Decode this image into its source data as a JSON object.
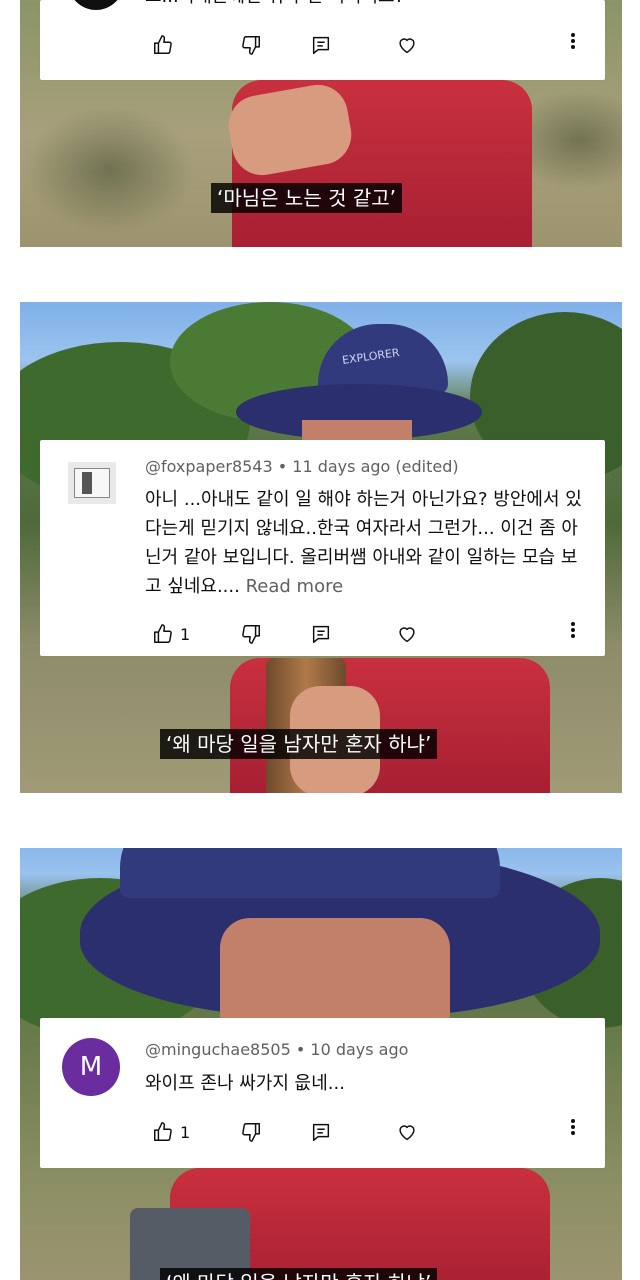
{
  "comments": [
    {
      "author_line": "",
      "text": "그...아내분께선 뭐하 신 여지리요?",
      "more_label": "",
      "likes": "",
      "avatar_letter": "",
      "avatar_color": "#0f0f0f"
    },
    {
      "author_line": "@foxpaper8543 • 11 days ago (edited)",
      "text": "아니 ...아내도 같이 일 해야 하는거 아닌가요? 방안에서 있다는게 믿기지 않네요..한국 여자라서 그런가... 이건 좀 아닌거 같아 보입니다. 올리버쌤 아내와 같이 일하는 모습 보고 싶네요....",
      "more_label": "Read more",
      "likes": "1",
      "avatar_letter": "",
      "avatar_color": "#e8e8e8"
    },
    {
      "author_line": "@minguchae8505 • 10 days ago",
      "text": "와이프 존나 싸가지 읎네...",
      "more_label": "",
      "likes": "1",
      "avatar_letter": "M",
      "avatar_color": "#6a2c9e"
    }
  ],
  "subtitles": [
    "‘마님은 노는 것 같고’",
    "‘왜 마당 일을 남자만 혼자 하냐’",
    "‘왜 마당 일을 남자만 혼자 하냐’"
  ],
  "video": {
    "hat_logo": "EXPLORER"
  },
  "icons": [
    "thumb-up-icon",
    "thumb-down-icon",
    "reply-icon",
    "heart-icon",
    "more-vert-icon"
  ]
}
